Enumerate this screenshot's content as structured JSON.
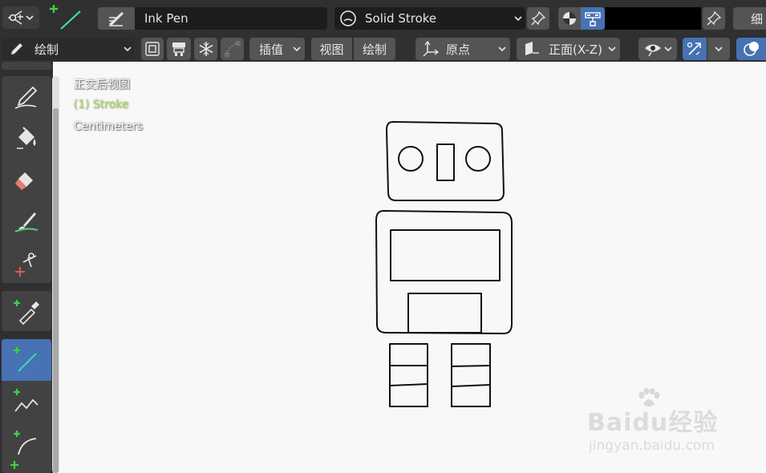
{
  "header": {
    "brush_name": "Ink Pen",
    "material_name": "Solid Stroke",
    "right_partial_label": "细"
  },
  "toolbar": {
    "mode_label": "绘制",
    "interpolate_label": "插值",
    "view_label": "视图",
    "draw_label": "绘制",
    "origin_label": "原点",
    "orientation_label": "正面(X-Z)"
  },
  "viewport": {
    "view_name": "正交后视图",
    "object_name": "(1) Stroke",
    "units": "Centimeters"
  },
  "watermark": {
    "brand": "Baidu经验",
    "url": "jingyan.baidu.com"
  },
  "colors": {
    "header_bg": "#303030",
    "field_bg": "#1d1d1d",
    "button_bg": "#545454",
    "active_blue": "#4772b3",
    "canvas_bg": "#f8f8f8",
    "object_text": "#a7d36a",
    "add_plus": "#3fd13f"
  },
  "icons": {
    "editor_type": "grease-pencil-icon",
    "draw_tool": "pencil-line-icon",
    "tools": [
      "draw-icon",
      "fill-icon",
      "erase-icon",
      "tint-icon",
      "cutter-icon",
      "eyedropper-icon",
      "line-icon",
      "polyline-icon",
      "arc-icon"
    ]
  }
}
